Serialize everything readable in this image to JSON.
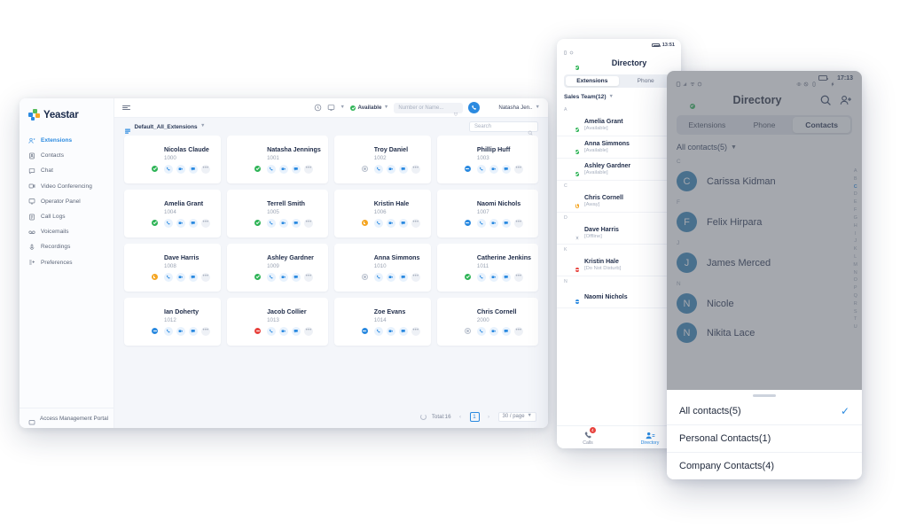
{
  "desktop": {
    "brand": "Yeastar",
    "sidebar": {
      "items": [
        {
          "label": "Extensions",
          "icon": "extensions-icon",
          "active": true
        },
        {
          "label": "Contacts",
          "icon": "contacts-icon",
          "active": false
        },
        {
          "label": "Chat",
          "icon": "chat-icon",
          "active": false
        },
        {
          "label": "Video Conferencing",
          "icon": "video-icon",
          "active": false
        },
        {
          "label": "Operator Panel",
          "icon": "operator-panel-icon",
          "active": false
        },
        {
          "label": "Call Logs",
          "icon": "call-logs-icon",
          "active": false
        },
        {
          "label": "Voicemails",
          "icon": "voicemail-icon",
          "active": false
        },
        {
          "label": "Recordings",
          "icon": "recordings-icon",
          "active": false
        },
        {
          "label": "Preferences",
          "icon": "preferences-icon",
          "active": false
        }
      ],
      "footer_label": "Access Management Portal"
    },
    "topbar": {
      "status_label": "Available",
      "search_placeholder": "Number or Name...",
      "user_name": "Natasha Jen..",
      "status_color": "#2fb457"
    },
    "toolbar": {
      "group_label": "Default_All_Extensions",
      "search_placeholder": "Search"
    },
    "pager": {
      "total_label": "Total:16",
      "prev": "‹",
      "page": "1",
      "next": "›",
      "page_size": "30 / page"
    },
    "cards": [
      {
        "name": "Nicolas Claude",
        "ext": "1000",
        "status": "available",
        "skin": "#e8b48e",
        "hair": "#4a342a",
        "shirt": "#2f6fae",
        "bg": "#cfe0ee"
      },
      {
        "name": "Natasha Jennings",
        "ext": "1001",
        "status": "available",
        "skin": "#edc0a1",
        "hair": "#7a4327",
        "shirt": "#d8dde5",
        "bg": "#e7e2dc"
      },
      {
        "name": "Troy Daniel",
        "ext": "1002",
        "status": "offline",
        "skin": "#eac3a3",
        "hair": "#b58a5e",
        "shirt": "#3c5878",
        "bg": "#d7cfc7"
      },
      {
        "name": "Phillip Huff",
        "ext": "1003",
        "status": "dnd",
        "skin": "#e0ab83",
        "hair": "#2d2420",
        "shirt": "#4f7fae",
        "bg": "#f0b7c3"
      },
      {
        "name": "Amelia Grant",
        "ext": "1004",
        "status": "available",
        "skin": "#f0c8a8",
        "hair": "#3a2a22",
        "shirt": "#e9eaee",
        "bg": "#d6e4f0"
      },
      {
        "name": "Terrell Smith",
        "ext": "1005",
        "status": "available",
        "skin": "#8d6244",
        "hair": "#3b3733",
        "shirt": "#cfd6de",
        "bg": "#cfd9e2"
      },
      {
        "name": "Kristin Hale",
        "ext": "1006",
        "status": "away",
        "skin": "#8a5a3c",
        "hair": "#2b211c",
        "shirt": "#f2b33a",
        "bg": "#e3d9cd"
      },
      {
        "name": "Naomi Nichols",
        "ext": "1007",
        "status": "dnd",
        "skin": "#f0c6a6",
        "hair": "#5a3c28",
        "shirt": "#cdd5de",
        "bg": "#dfe5ea"
      },
      {
        "name": "Dave Harris",
        "ext": "1008",
        "status": "away",
        "skin": "#dfa97f",
        "hair": "#30261f",
        "shirt": "#e6e8ec",
        "bg": "#cdc6d6"
      },
      {
        "name": "Ashley Gardner",
        "ext": "1009",
        "status": "available",
        "skin": "#f2cdb0",
        "hair": "#3a2b22",
        "shirt": "#b9cddd",
        "bg": "#d9e3ec"
      },
      {
        "name": "Anna Simmons",
        "ext": "1010",
        "status": "offline",
        "skin": "#f2cbae",
        "hair": "#b2623a",
        "shirt": "#eceef1",
        "bg": "#e9e3dd"
      },
      {
        "name": "Catherine Jenkins",
        "ext": "1011",
        "status": "available",
        "skin": "#e9c0a0",
        "hair": "#402c22",
        "shirt": "#2f3a46",
        "bg": "#ded7cf"
      },
      {
        "name": "Ian Doherty",
        "ext": "1012",
        "status": "dnd",
        "skin": "#d7a57e",
        "hair": "#9b9a98",
        "shirt": "#20242c",
        "bg": "#c8c3bd"
      },
      {
        "name": "Jacob Collier",
        "ext": "1013",
        "status": "busy",
        "skin": "#69452e",
        "hair": "#241c18",
        "shirt": "#e7e9ec",
        "bg": "#d8dde3"
      },
      {
        "name": "Zoe Evans",
        "ext": "1014",
        "status": "dnd",
        "skin": "#f1c9ab",
        "hair": "#2e2119",
        "shirt": "#2b3242",
        "bg": "#ded6ce"
      },
      {
        "name": "Chris Cornell",
        "ext": "2000",
        "status": "offline",
        "skin": "#d9a87f",
        "hair": "#3a2b20",
        "shirt": "#6d7c8c",
        "bg": "#cfd6dd"
      }
    ],
    "action_icons": [
      "phone-icon",
      "video-icon",
      "chat-icon",
      "more-icon"
    ]
  },
  "tablet": {
    "statusbar": {
      "time": "13:51"
    },
    "header": {
      "title": "Directory"
    },
    "tabs": [
      {
        "label": "Extensions",
        "active": true
      },
      {
        "label": "Phone",
        "active": false
      }
    ],
    "group_label": "Sales Team(12)",
    "sections": [
      {
        "letter": "A",
        "rows": [
          {
            "name": "Amelia Grant",
            "status": "[Available]",
            "state": "available",
            "skin": "#f0c8a8",
            "hair": "#3a2a22",
            "shirt": "#e9eaee",
            "bg": "#d6e4f0"
          },
          {
            "name": "Anna  Simmons",
            "status": "[Available]",
            "state": "available",
            "skin": "#f2cbae",
            "hair": "#b2623a",
            "shirt": "#eceef1",
            "bg": "#e9e3dd"
          },
          {
            "name": "Ashley Gardner",
            "status": "[Available]",
            "state": "available",
            "skin": "#f2cdb0",
            "hair": "#3a2b22",
            "shirt": "#b9cddd",
            "bg": "#d9e3ec"
          }
        ]
      },
      {
        "letter": "C",
        "rows": [
          {
            "name": "Chris Cornell",
            "status": "[Away]",
            "state": "away",
            "skin": "#d9a87f",
            "hair": "#3a2b20",
            "shirt": "#6d7c8c",
            "bg": "#cfd6dd"
          }
        ]
      },
      {
        "letter": "D",
        "rows": [
          {
            "name": "Dave  Harris",
            "status": "[Offline]",
            "state": "offline",
            "skin": "#dfa97f",
            "hair": "#30261f",
            "shirt": "#e6e8ec",
            "bg": "#cdc6d6"
          }
        ]
      },
      {
        "letter": "K",
        "rows": [
          {
            "name": "Kristin Hale",
            "status": "[Do Not Disturb]",
            "state": "busy",
            "skin": "#8a5a3c",
            "hair": "#2b211c",
            "shirt": "#f2b33a",
            "bg": "#e3d9cd"
          }
        ]
      },
      {
        "letter": "N",
        "rows": [
          {
            "name": "Naomi Nichols",
            "status": "",
            "state": "dnd",
            "skin": "#f0c6a6",
            "hair": "#5a3c28",
            "shirt": "#cdd5de",
            "bg": "#dfe5ea"
          }
        ]
      }
    ],
    "nav": [
      {
        "label": "Calls",
        "icon": "calls-icon",
        "badge": "4",
        "active": false
      },
      {
        "label": "Directory",
        "icon": "directory-icon",
        "badge": "",
        "active": true
      }
    ]
  },
  "phone": {
    "statusbar": {
      "time": "17:13"
    },
    "header": {
      "title": "Directory",
      "search_icon": "search-icon",
      "add_contact_icon": "add-contact-icon"
    },
    "tabs": [
      {
        "label": "Extensions",
        "active": false
      },
      {
        "label": "Phone",
        "active": false
      },
      {
        "label": "Contacts",
        "active": true
      }
    ],
    "filter_label": "All contacts(5)",
    "sections": [
      {
        "letter": "C",
        "rows": [
          {
            "name": "Carissa Kidman",
            "initial": "C"
          }
        ]
      },
      {
        "letter": "F",
        "rows": [
          {
            "name": "Felix Hirpara",
            "initial": "F"
          }
        ]
      },
      {
        "letter": "J",
        "rows": [
          {
            "name": "James Merced",
            "initial": "J"
          }
        ]
      },
      {
        "letter": "N",
        "rows": [
          {
            "name": "Nicole",
            "initial": "N"
          },
          {
            "name": "Nikita Lace",
            "initial": "N"
          }
        ]
      }
    ],
    "index_letters": [
      "A",
      "B",
      "C",
      "D",
      "E",
      "F",
      "G",
      "H",
      "I",
      "J",
      "K",
      "L",
      "M",
      "N",
      "O",
      "P",
      "Q",
      "R",
      "S",
      "T",
      "U"
    ],
    "index_active": "C",
    "sheet": {
      "items": [
        {
          "label": "All contacts(5)",
          "checked": true
        },
        {
          "label": "Personal Contacts(1)",
          "checked": false
        },
        {
          "label": "Company Contacts(4)",
          "checked": false
        }
      ],
      "check_glyph": "✓"
    },
    "avatar": {
      "skin": "#e8b48e",
      "hair": "#4a342a",
      "shirt": "#2f6fae",
      "bg": "#cfe0ee"
    },
    "accent": "#2b8ae0"
  }
}
